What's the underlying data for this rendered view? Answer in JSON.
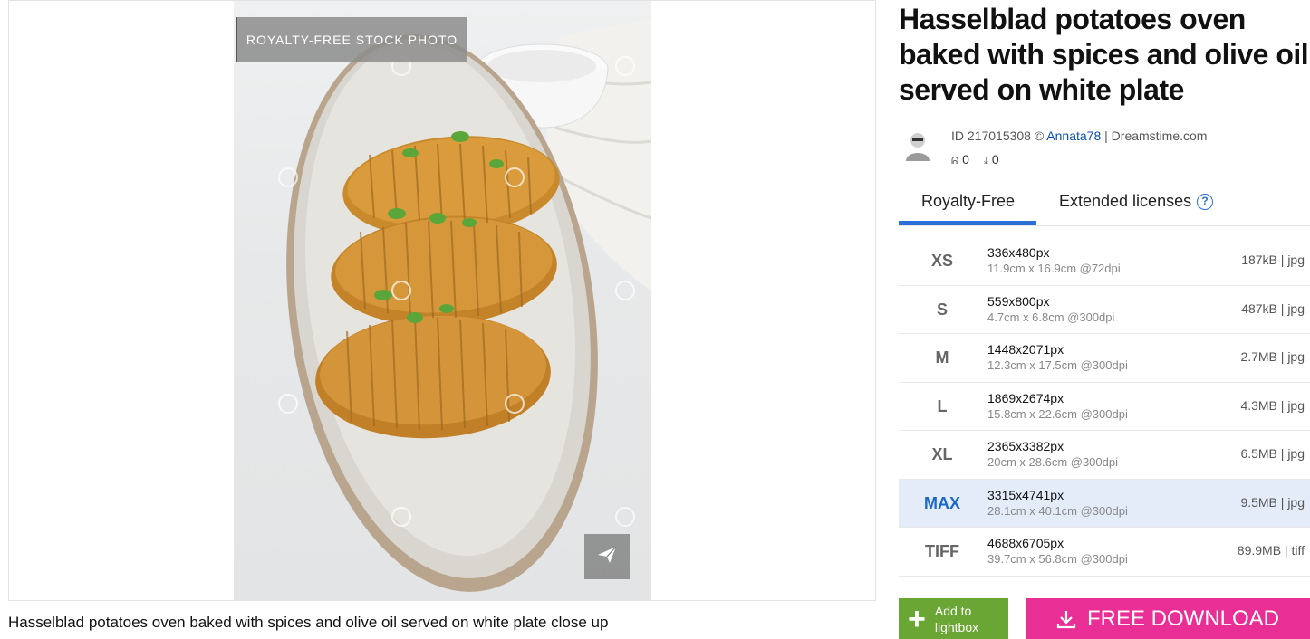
{
  "image_panel": {
    "badge": "ROYALTY-FREE STOCK PHOTO",
    "caption": "Hasselblad potatoes oven baked with spices and olive oil served on white plate close up",
    "share_icon": "paper-plane-icon"
  },
  "details": {
    "title": "Hasselblad potatoes oven baked with spices and olive oil served on white plate",
    "id_text": "ID 217015308 ©",
    "author": "Annata78",
    "site": "| Dreamstime.com",
    "views": "0",
    "downloads": "0"
  },
  "tabs": {
    "royalty_free": "Royalty-Free",
    "extended": "Extended licenses",
    "help": "?"
  },
  "sizes": [
    {
      "code": "XS",
      "px": "336x480px",
      "cm": "11.9cm x 16.9cm @72dpi",
      "file": "187kB | jpg"
    },
    {
      "code": "S",
      "px": "559x800px",
      "cm": "4.7cm x 6.8cm @300dpi",
      "file": "487kB | jpg"
    },
    {
      "code": "M",
      "px": "1448x2071px",
      "cm": "12.3cm x 17.5cm @300dpi",
      "file": "2.7MB | jpg"
    },
    {
      "code": "L",
      "px": "1869x2674px",
      "cm": "15.8cm x 22.6cm @300dpi",
      "file": "4.3MB | jpg"
    },
    {
      "code": "XL",
      "px": "2365x3382px",
      "cm": "20cm x 28.6cm @300dpi",
      "file": "6.5MB | jpg"
    },
    {
      "code": "MAX",
      "px": "3315x4741px",
      "cm": "28.1cm x 40.1cm @300dpi",
      "file": "9.5MB | jpg"
    },
    {
      "code": "TIFF",
      "px": "4688x6705px",
      "cm": "39.7cm x 56.8cm @300dpi",
      "file": "89.9MB | tiff"
    }
  ],
  "actions": {
    "lightbox_line1": "Add to",
    "lightbox_line2": "lightbox",
    "download": "FREE DOWNLOAD"
  },
  "colors": {
    "accent_blue": "#2a6fd6",
    "download_pink": "#e92e96",
    "lightbox_green": "#6aa633",
    "selected_row": "#e4ecfa"
  }
}
